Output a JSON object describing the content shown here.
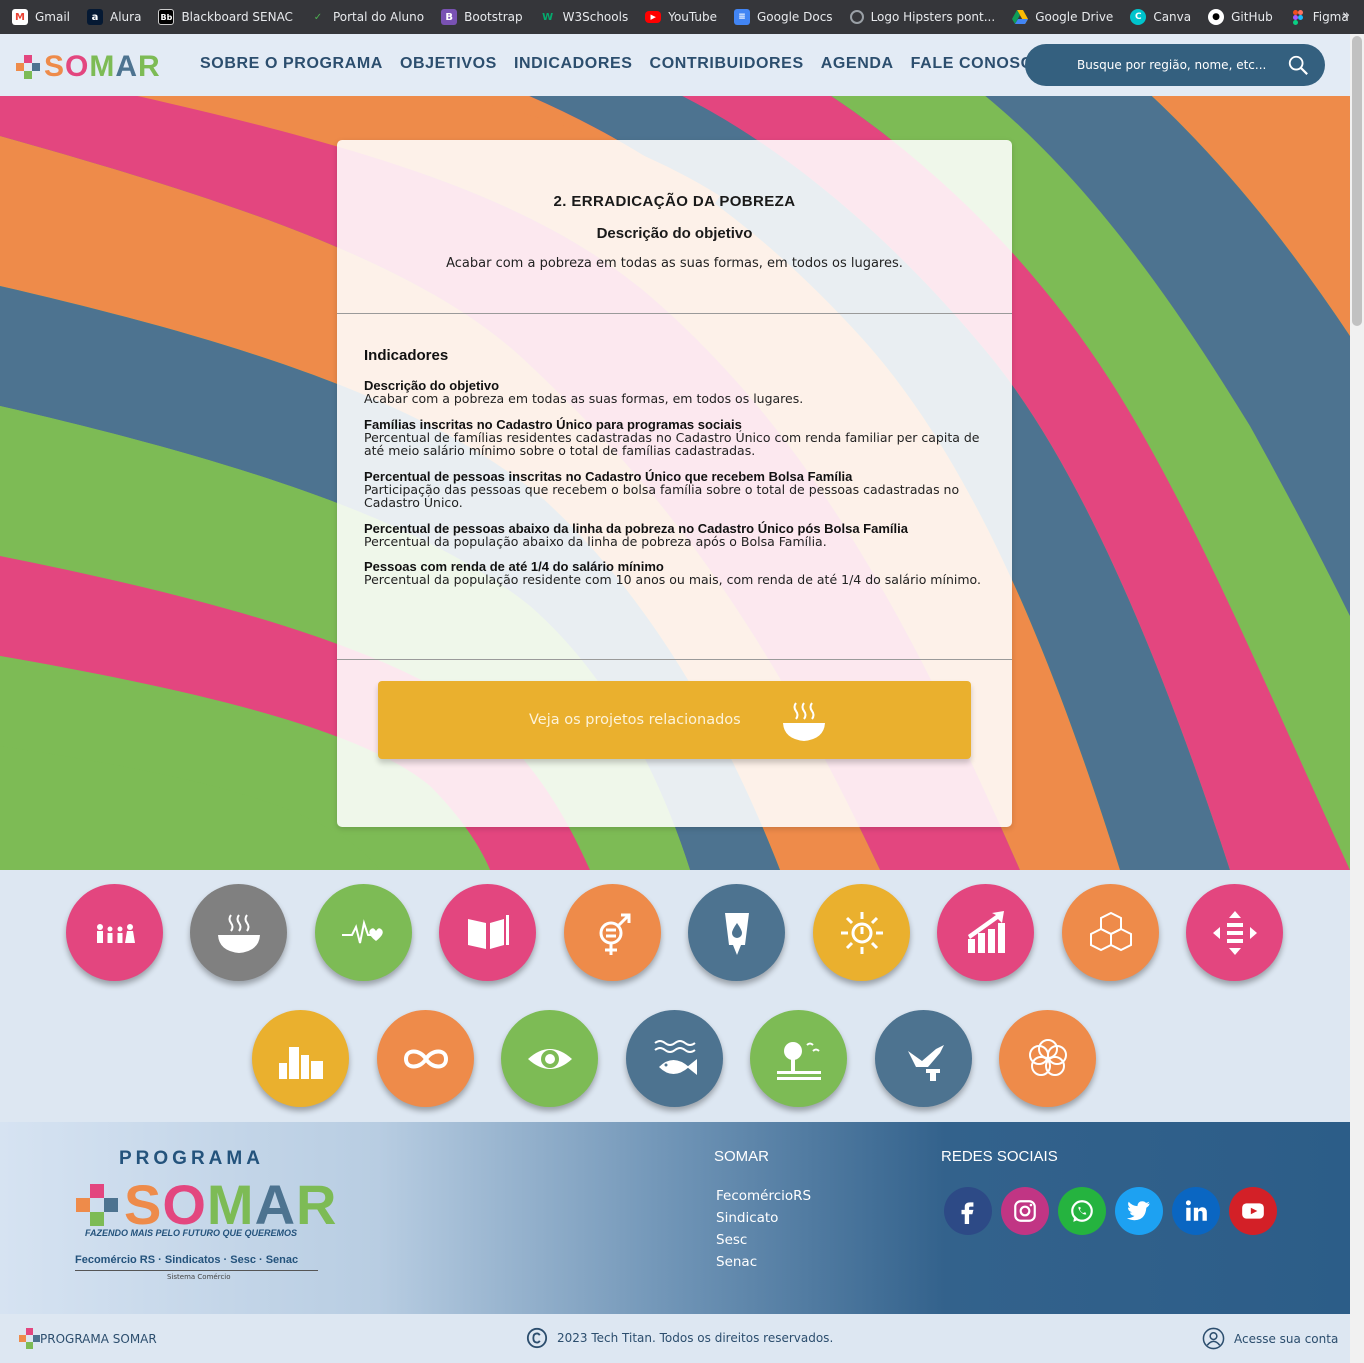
{
  "bookmarks": [
    {
      "label": "Gmail",
      "icon": "gmail-icon",
      "color": "#ea4335"
    },
    {
      "label": "Alura",
      "icon": "alura-icon",
      "color": "#051933"
    },
    {
      "label": "Blackboard SENAC",
      "icon": "blackboard-icon",
      "color": "#000000"
    },
    {
      "label": "Portal do Aluno",
      "icon": "portal-icon",
      "color": "#2e7d32"
    },
    {
      "label": "Bootstrap",
      "icon": "bootstrap-icon",
      "color": "#7952b3"
    },
    {
      "label": "W3Schools",
      "icon": "w3schools-icon",
      "color": "#04aa6d"
    },
    {
      "label": "YouTube",
      "icon": "youtube-icon",
      "color": "#ff0000"
    },
    {
      "label": "Google Docs",
      "icon": "google-docs-icon",
      "color": "#4285f4"
    },
    {
      "label": "Logo Hipsters pont...",
      "icon": "globe-icon",
      "color": "#5f6368"
    },
    {
      "label": "Google Drive",
      "icon": "google-drive-icon",
      "color": "#fbbc04"
    },
    {
      "label": "Canva",
      "icon": "canva-icon",
      "color": "#00c4cc"
    },
    {
      "label": "GitHub",
      "icon": "github-icon",
      "color": "#24292e"
    },
    {
      "label": "Figma",
      "icon": "figma-icon",
      "color": "#f24e1e"
    }
  ],
  "bookmarks_more": "»",
  "header": {
    "logo_text": "SOMAR",
    "nav": [
      "SOBRE O PROGRAMA",
      "OBJETIVOS",
      "INDICADORES",
      "CONTRIBUIDORES",
      "AGENDA",
      "FALE CONOSCO"
    ],
    "search_placeholder": "Busque por região, nome, etc..."
  },
  "objective": {
    "title": "2. ERRADICAÇÃO DA POBREZA",
    "subtitle": "Descrição do objetivo",
    "description": "Acabar com a pobreza em todas as suas formas, em todos os lugares.",
    "indicators_heading": "Indicadores",
    "indicators": [
      {
        "name": "Descrição do objetivo",
        "text": "Acabar com a pobreza em todas as suas formas, em todos os lugares."
      },
      {
        "name": "Famílias inscritas no Cadastro Único para programas sociais",
        "text": "Percentual de famílias residentes cadastradas no Cadastro Único com renda familiar per capita de até meio salário mínimo sobre o total de famílias cadastradas."
      },
      {
        "name": "Percentual de pessoas inscritas no Cadastro Único que recebem Bolsa Família",
        "text": "Participação das pessoas que recebem o bolsa família sobre o total de pessoas cadastradas no Cadastro Único."
      },
      {
        "name": "Percentual de pessoas abaixo da linha da pobreza no Cadastro Único pós Bolsa Família",
        "text": "Percentual da população abaixo da linha de pobreza após o Bolsa Família."
      },
      {
        "name": "Pessoas com renda de até 1/4 do salário mínimo",
        "text": "Percentual da população residente com 10 anos ou mais, com renda de até 1/4 do salário mínimo."
      }
    ],
    "cta_label": "Veja os projetos relacionados"
  },
  "goals": [
    {
      "icon": "family-icon",
      "color": "#e3467f"
    },
    {
      "icon": "food-bowl-icon",
      "color": "#808080"
    },
    {
      "icon": "heartbeat-icon",
      "color": "#7dbb55"
    },
    {
      "icon": "book-icon",
      "color": "#e3467f"
    },
    {
      "icon": "gender-equality-icon",
      "color": "#ee8b4a"
    },
    {
      "icon": "water-drop-icon",
      "color": "#4d7390"
    },
    {
      "icon": "energy-sun-icon",
      "color": "#eab02e"
    },
    {
      "icon": "growth-chart-icon",
      "color": "#e3467f"
    },
    {
      "icon": "cubes-icon",
      "color": "#ee8b4a"
    },
    {
      "icon": "reduced-inequality-icon",
      "color": "#e3467f"
    },
    {
      "icon": "city-icon",
      "color": "#eab02e"
    },
    {
      "icon": "infinity-icon",
      "color": "#ee8b4a"
    },
    {
      "icon": "eye-globe-icon",
      "color": "#7dbb55"
    },
    {
      "icon": "fish-icon",
      "color": "#4d7390"
    },
    {
      "icon": "tree-land-icon",
      "color": "#7dbb55"
    },
    {
      "icon": "dove-icon",
      "color": "#4d7390"
    },
    {
      "icon": "partnership-circles-icon",
      "color": "#ee8b4a"
    }
  ],
  "footer": {
    "program_label": "PROGRAMA",
    "logo_text": "SOMAR",
    "tagline": "FAZENDO MAIS PELO FUTURO QUE QUEREMOS",
    "partners": "Fecomércio RS  ·  Sindicatos  ·  Sesc  ·  Senac",
    "sistema": "Sistema Comércio",
    "somar_title": "SOMAR",
    "somar_links": [
      "FecomércioRS",
      "Sindicato",
      "Sesc",
      "Senac"
    ],
    "social_title": "REDES SOCIAIS",
    "socials": [
      {
        "icon": "facebook-icon",
        "color": "#2d5aa0"
      },
      {
        "icon": "instagram-icon",
        "color": "#c13584"
      },
      {
        "icon": "whatsapp-icon",
        "color": "#25b33f"
      },
      {
        "icon": "twitter-icon",
        "color": "#1da1f2"
      },
      {
        "icon": "linkedin-icon",
        "color": "#0a66c2"
      },
      {
        "icon": "youtube-icon",
        "color": "#d32027"
      }
    ]
  },
  "bottom": {
    "brand": "PROGRAMA SOMAR",
    "copyright": "2023 Tech Titan. Todos os direitos reservados.",
    "account": "Acesse sua conta"
  },
  "colors": {
    "navy": "#2c4e6e",
    "pink": "#e3467f",
    "orange": "#ee8b4a",
    "green": "#7dbb55",
    "slate": "#4d7390",
    "yellow": "#eab02e"
  }
}
